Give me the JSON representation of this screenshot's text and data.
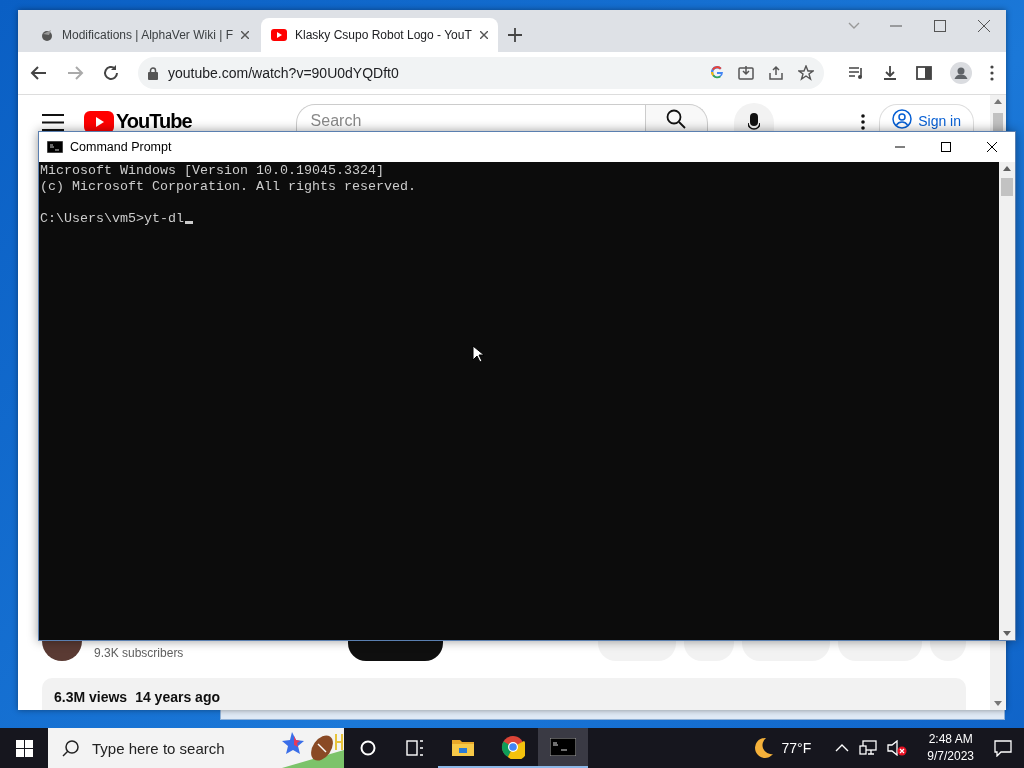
{
  "browser": {
    "tabs": [
      {
        "title": "Modifications | AlphaVer Wiki | F",
        "selected": false
      },
      {
        "title": "Klasky Csupo Robot Logo - YouT",
        "selected": true
      }
    ],
    "address": "youtube.com/watch?v=90U0dYQDft0",
    "page": {
      "logo": "YouTube",
      "search_placeholder": "Search",
      "sign_in": "Sign in",
      "subscribers": "9.3K subscribers",
      "views": "6.3M views",
      "age": "14 years ago"
    }
  },
  "cmd": {
    "title": "Command Prompt",
    "banner": [
      "Microsoft Windows [Version 10.0.19045.3324]",
      "(c) Microsoft Corporation. All rights reserved."
    ],
    "prompt": "C:\\Users\\vm5>yt-dl"
  },
  "taskbar": {
    "search_placeholder": "Type here to search",
    "apps": [
      {
        "kind": "explorer",
        "active": false
      },
      {
        "kind": "chrome",
        "active": false
      },
      {
        "kind": "terminal",
        "active": true
      }
    ],
    "weather": "77°F",
    "time": "2:48 AM",
    "date": "9/7/2023"
  }
}
